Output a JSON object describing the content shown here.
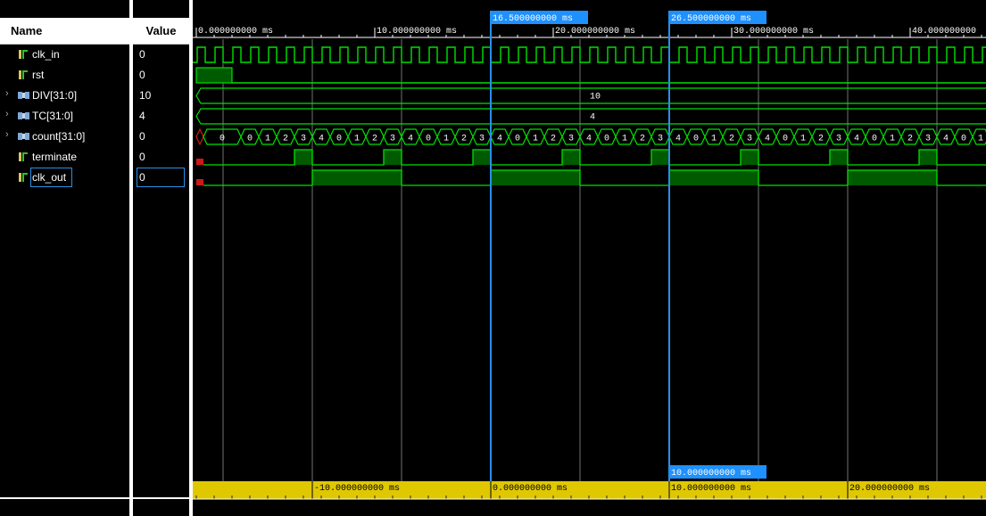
{
  "headers": {
    "name": "Name",
    "value": "Value"
  },
  "signals": [
    {
      "name": "clk_in",
      "value": "0",
      "icon": "bit-signal-icon",
      "expandable": false
    },
    {
      "name": "rst",
      "value": "0",
      "icon": "bit-signal-icon",
      "expandable": false
    },
    {
      "name": "DIV[31:0]",
      "value": "10",
      "icon": "bus-signal-icon",
      "expandable": true
    },
    {
      "name": "TC[31:0]",
      "value": "4",
      "icon": "bus-signal-icon",
      "expandable": true
    },
    {
      "name": "count[31:0]",
      "value": "0",
      "icon": "bus-signal-icon",
      "expandable": true
    },
    {
      "name": "terminate",
      "value": "0",
      "icon": "bit-signal-icon",
      "expandable": false
    },
    {
      "name": "clk_out",
      "value": "0",
      "icon": "bit-signal-icon",
      "expandable": false,
      "selected": true
    }
  ],
  "time_ruler": {
    "labels": [
      "0.000000000 ms",
      "10.000000000 ms",
      "20.000000000 ms",
      "30.000000000 ms",
      "40.000000000"
    ]
  },
  "cursors": [
    {
      "label": "16.500000000 ms"
    },
    {
      "label": "26.500000000 ms"
    }
  ],
  "cursor_delta": "10.000000000 ms",
  "bottom_ruler": {
    "labels": [
      "-10.000000000 ms",
      "0.000000000 ms",
      "10.000000000 ms",
      "20.000000000 ms"
    ]
  },
  "bus_values": {
    "DIV": "10",
    "TC": "4",
    "count_initial": "0",
    "count_cycle": [
      "0",
      "1",
      "2",
      "3",
      "4"
    ]
  },
  "colors": {
    "wave": "#00e000",
    "wave_fill": "#005a00",
    "cursor": "#2a8fe8",
    "cursor_label_bg": "#1e90ff",
    "undefined": "#d01818",
    "bottom_bar": "#e0c800",
    "grid": "#ffffff"
  }
}
